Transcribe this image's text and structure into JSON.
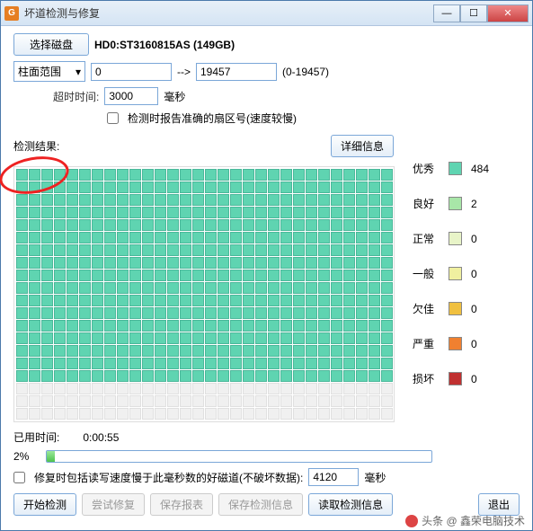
{
  "window": {
    "title": "坏道检测与修复"
  },
  "winbtns": {
    "min": "—",
    "max": "☐",
    "close": "✕"
  },
  "toolbar": {
    "select_disk": "选择磁盘",
    "disk_info": "HD0:ST3160815AS (149GB)"
  },
  "range": {
    "type_label": "柱面范围",
    "from": "0",
    "arrow": "-->",
    "to": "19457",
    "total": "(0-19457)"
  },
  "timeout": {
    "label": "超时时间:",
    "value": "3000",
    "unit": "毫秒"
  },
  "accurate": {
    "label": "检测时报告准确的扇区号(速度较慢)"
  },
  "results": {
    "label": "检测结果:",
    "detail_btn": "详细信息"
  },
  "legend": [
    {
      "name": "优秀",
      "color": "#5fd4b1",
      "count": "484"
    },
    {
      "name": "良好",
      "color": "#a8e6a8",
      "count": "2"
    },
    {
      "name": "正常",
      "color": "#e8f4c8",
      "count": "0"
    },
    {
      "name": "一般",
      "color": "#f0f0a0",
      "count": "0"
    },
    {
      "name": "欠佳",
      "color": "#f0c040",
      "count": "0"
    },
    {
      "name": "严重",
      "color": "#f08030",
      "count": "0"
    },
    {
      "name": "损坏",
      "color": "#c03030",
      "count": "0"
    }
  ],
  "elapsed": {
    "label": "已用时间:",
    "value": "0:00:55"
  },
  "progress": {
    "percent": "2%",
    "value": 2
  },
  "repair_opt": {
    "label": "修复时包括读写速度慢于此毫秒数的好磁道(不破坏数据):",
    "value": "4120",
    "unit": "毫秒"
  },
  "buttons": {
    "start": "开始检测",
    "try_repair": "尝试修复",
    "save_report": "保存报表",
    "save_info": "保存检测信息",
    "load_info": "读取检测信息",
    "exit": "退出"
  },
  "grid_meta": {
    "cols": 30,
    "rows": 20,
    "filled_rows": 17
  },
  "watermark": {
    "text": "头条 @ 鑫荣电脑技术"
  }
}
